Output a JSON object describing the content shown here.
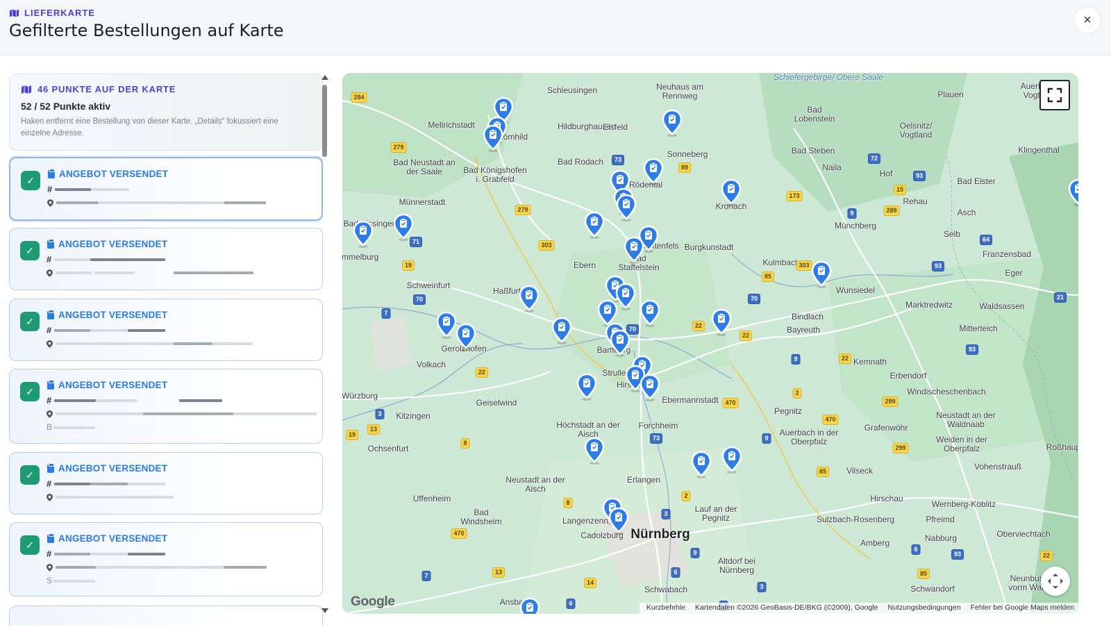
{
  "header": {
    "eyebrow": "LIEFERKARTE",
    "title": "Gefilterte Bestellungen auf Karte",
    "close_label": "×"
  },
  "summary": {
    "points_label": "46 PUNKTE AUF DER KARTE",
    "active_label": "52 / 52 Punkte aktiv",
    "hint": "Haken entfernt eine Bestellung von dieser Karte. „Details“ fokussiert eine einzelne Adresse."
  },
  "orders": [
    {
      "status": "ANGEBOT VERSENDET",
      "hash": "#",
      "checked": true,
      "sub": ""
    },
    {
      "status": "ANGEBOT VERSENDET",
      "hash": "#",
      "checked": true,
      "sub": ""
    },
    {
      "status": "ANGEBOT VERSENDET",
      "hash": "#",
      "checked": true,
      "sub": ""
    },
    {
      "status": "ANGEBOT VERSENDET",
      "hash": "#",
      "checked": true,
      "sub": "B"
    },
    {
      "status": "ANGEBOT VERSENDET",
      "hash": "#",
      "checked": true,
      "sub": ""
    },
    {
      "status": "ANGEBOT VERSENDET",
      "hash": "#",
      "checked": true,
      "sub": "S"
    }
  ],
  "map": {
    "places": [
      "Schleusingen",
      "Neuhaus am Rennweg",
      "Schiefergebirge/ Obere Saale",
      "Plauen",
      "Auerbach/ Vogtland",
      "Mellrichstadt",
      "Römhild",
      "Hildburghausen",
      "Eisfeld",
      "Bad Lobenstein",
      "Oelsnitz/ Vogtland",
      "Bad Neustadt an der Saale",
      "Bad Königshofen i. Grabfeld",
      "Bad Rodach",
      "Sonneberg",
      "Bad Steben",
      "Naila",
      "Klingenthal",
      "Rödental",
      "Hof",
      "Bad Elster",
      "Münnerstadt",
      "Kronach",
      "Rehau",
      "Asch",
      "Münchberg",
      "Selb",
      "Lichtenfels",
      "Burgkunstadt",
      "Ebern",
      "Bad Staffelstein",
      "Kulmbach",
      "Franzensbad",
      "Eger",
      "Schweinfurt",
      "Haßfurt",
      "Wunsiedel",
      "Marktredwitz",
      "Waldsassen",
      "Bindlach",
      "Bayreuth",
      "Mitterteich",
      "Gerolzhofen",
      "Bamberg",
      "Volkach",
      "Kemnath",
      "Erbendorf",
      "Würzburg",
      "Geiselwind",
      "Strullendorf",
      "Hirschaid",
      "Ebermannstadt",
      "Windischeschenbach",
      "Kitzingen",
      "Pegnitz",
      "Neustadt an der Waldnaab",
      "Höchstadt an der Aisch",
      "Forchheim",
      "Auerbach in der Oberpfalz",
      "Grafenwöhr",
      "Ochsenfurt",
      "Weiden in der Oberpfalz",
      "Roßhaupt",
      "Neustadt an der Aisch",
      "Erlangen",
      "Vilseck",
      "Vohenstrauß",
      "Uffenheim",
      "Bad Windsheim",
      "Langenzenn",
      "Lauf an der Pegnitz",
      "Hirschau",
      "Wernberg-Köblitz",
      "Sulzbach-Rosenberg",
      "Pfreimd",
      "Cadolzburg",
      "Nürnberg",
      "Nabburg",
      "Oberviechtach",
      "Amberg",
      "Altdorf bei Nürnberg",
      "Schwabach",
      "Schwandorf",
      "Neunburg vorm Wald",
      "Ansbach",
      "Bad Kissingen",
      "Hammelburg"
    ],
    "google_label": "Google",
    "attribution": [
      "Kurzbefehle",
      "Kartendaten ©2026 GeoBasis-DE/BKG (©2009), Google",
      "Nutzungsbedingungen",
      "Fehler bei Google Maps melden"
    ],
    "fullscreen_icon": "fullscreen-icon",
    "camera_control_icon": "move-camera-icon",
    "marker_count": 46
  },
  "colors": {
    "accent": "#4b3fd6",
    "status_blue": "#2a7be3",
    "check_green": "#1e9b73",
    "marker_blue": "#2e7de6"
  }
}
